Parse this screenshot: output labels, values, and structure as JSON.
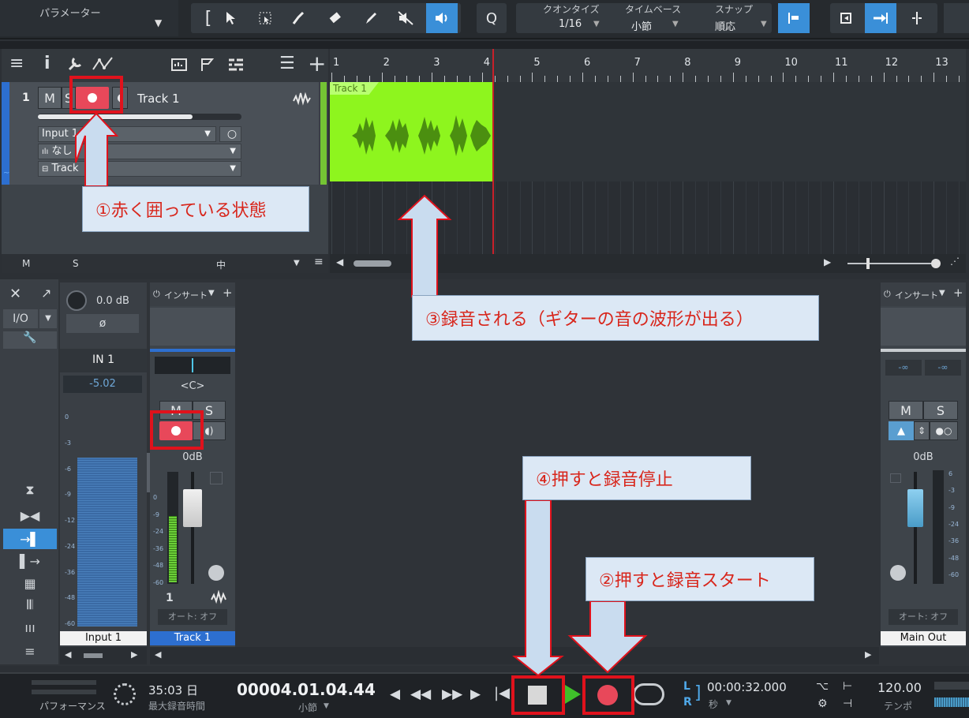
{
  "toolbar": {
    "parameter_label": "パラメーター",
    "quantize_label": "クオンタイズ",
    "quantize_value": "1/16",
    "timebase_label": "タイムベース",
    "timebase_value": "小節",
    "snap_label": "スナップ",
    "snap_value": "順応",
    "q_label": "Q"
  },
  "ruler": {
    "marks": [
      "1",
      "2",
      "3",
      "4",
      "5",
      "6",
      "7",
      "8",
      "9",
      "10",
      "11",
      "12",
      "13"
    ]
  },
  "track": {
    "number": "1",
    "mute": "M",
    "solo": "S",
    "name": "Track 1",
    "input": "Input 1",
    "insert": "なし",
    "output": "Track",
    "clip_name": "Track 1"
  },
  "header_footer": {
    "m": "M",
    "s": "S",
    "center": "中"
  },
  "mixer": {
    "io_label": "I/O",
    "input_gain": "0.0 dB",
    "phase": "ø",
    "in_name": "IN 1",
    "in_level": "-5.02",
    "in_label": "Input 1",
    "insert_label": "インサート",
    "pan": "<C>",
    "mute": "M",
    "solo": "S",
    "volume": "0dB",
    "channel_number": "1",
    "auto": "オート: オフ",
    "track_label": "Track 1",
    "main_insert_label": "インサート",
    "main_peak_l": "-∞",
    "main_peak_r": "-∞",
    "main_mute": "M",
    "main_solo": "S",
    "main_volume": "0dB",
    "main_auto": "オート: オフ",
    "main_label": "Main Out",
    "meter_scale_input": [
      "0",
      "-3",
      "-6",
      "-9",
      "-12",
      "-24",
      "-36",
      "-48",
      "-60"
    ],
    "meter_scale_track": [
      "0",
      "-9",
      "-24",
      "-36",
      "-48",
      "-60"
    ],
    "meter_scale_main": [
      "6",
      "-3",
      "-9",
      "-24",
      "-36",
      "-48",
      "-60"
    ]
  },
  "transport": {
    "performance": "パフォーマンス",
    "record_time": "35:03 日",
    "record_time_label": "最大録音時間",
    "position": "00004.01.04.44",
    "position_unit": "小節",
    "time": "00:00:32.000",
    "time_unit": "秒",
    "l": "L",
    "r": "R",
    "tempo": "120.00",
    "tempo_label": "テンポ"
  },
  "callouts": {
    "c1": "①赤く囲っている状態",
    "c2": "②押すと録音スタート",
    "c3": "③録音される（ギターの音の波形が出る）",
    "c4": "④押すと録音停止"
  },
  "colors": {
    "accent": "#3a8fd8",
    "record": "#e8485a",
    "clip": "#8ef51e",
    "callout_text": "#d8261c"
  }
}
